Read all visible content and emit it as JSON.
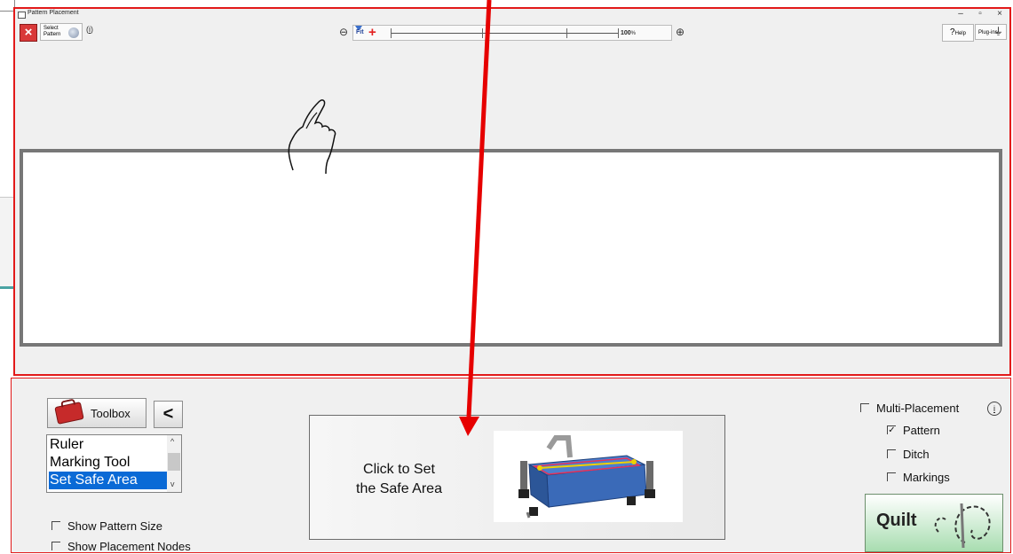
{
  "window": {
    "title": "Pattern Placement",
    "controls": {
      "minimize": "–",
      "restore": "▫",
      "close": "×"
    }
  },
  "toolbar": {
    "close_icon": "×",
    "select_pattern_label_1": "Select",
    "select_pattern_label_2": "Pattern",
    "info_label": "i",
    "zoom_out_icon": "⊖",
    "zoom_in_icon": "⊕",
    "zoom_fit_label": "Fit",
    "zoom_100_label": "100",
    "zoom_percent": "%",
    "help_q": "?",
    "help_label": "Help",
    "plugins_label": "Plug-ins"
  },
  "tools": {
    "toolbox_label": "Toolbox",
    "back_label": "<",
    "items": [
      "Ruler",
      "Marking Tool",
      "Set Safe Area"
    ],
    "selected_index": 2,
    "show_pattern_size": {
      "label": "Show Pattern Size",
      "checked": false
    },
    "show_placement_nodes": {
      "label": "Show Placement Nodes",
      "checked": false
    }
  },
  "safe_area_button": {
    "line1": "Click to Set",
    "line2": "the Safe Area"
  },
  "placement": {
    "multi_label": "Multi-Placement",
    "multi_checked": false,
    "info_label": "i",
    "options": [
      {
        "label": "Pattern",
        "checked": true
      },
      {
        "label": "Ditch",
        "checked": false
      },
      {
        "label": "Markings",
        "checked": false
      }
    ],
    "quilt_label": "Quilt"
  },
  "colors": {
    "accent_red": "#e21a1a",
    "selection_blue": "#0a6ad6",
    "quilt_green": "#a8ddb0"
  }
}
